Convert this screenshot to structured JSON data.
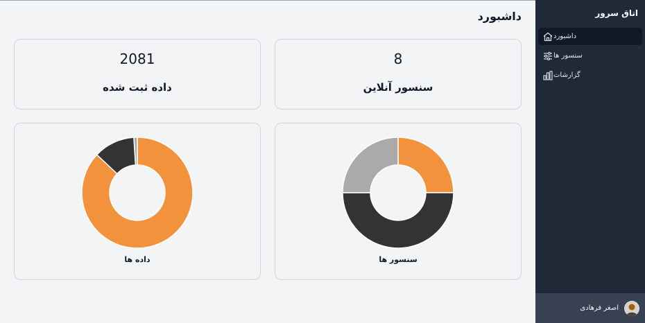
{
  "app": {
    "brand": "اتاق سرور"
  },
  "header": {
    "title": "داشبورد"
  },
  "sidebar": {
    "items": [
      {
        "label": "داشبورد",
        "icon": "home-icon",
        "active": true
      },
      {
        "label": "سنسور ها",
        "icon": "sliders-icon",
        "active": false
      },
      {
        "label": "گزارشات",
        "icon": "bar-chart-icon",
        "active": false
      }
    ]
  },
  "user": {
    "name": "اصغر فرهادی"
  },
  "stats": [
    {
      "value": "2081",
      "label": "داده ثبت شده"
    },
    {
      "value": "8",
      "label": "سنسور آنلاین"
    }
  ],
  "colors": {
    "orange": "#f2923d",
    "dark": "#333333",
    "gray": "#aaaaaa",
    "sidebar": "#1f2937"
  },
  "chart_data": [
    {
      "type": "pie",
      "title": "سنسور ها",
      "series": [
        {
          "values": [
            25,
            50,
            25
          ],
          "colors": [
            "#f2923d",
            "#333333",
            "#aaaaaa"
          ]
        }
      ],
      "hole": 0.5
    },
    {
      "type": "pie",
      "title": "داده ها",
      "series": [
        {
          "values": [
            87,
            12,
            1
          ],
          "colors": [
            "#f2923d",
            "#333333",
            "#aaaaaa"
          ]
        }
      ],
      "hole": 0.5
    }
  ]
}
